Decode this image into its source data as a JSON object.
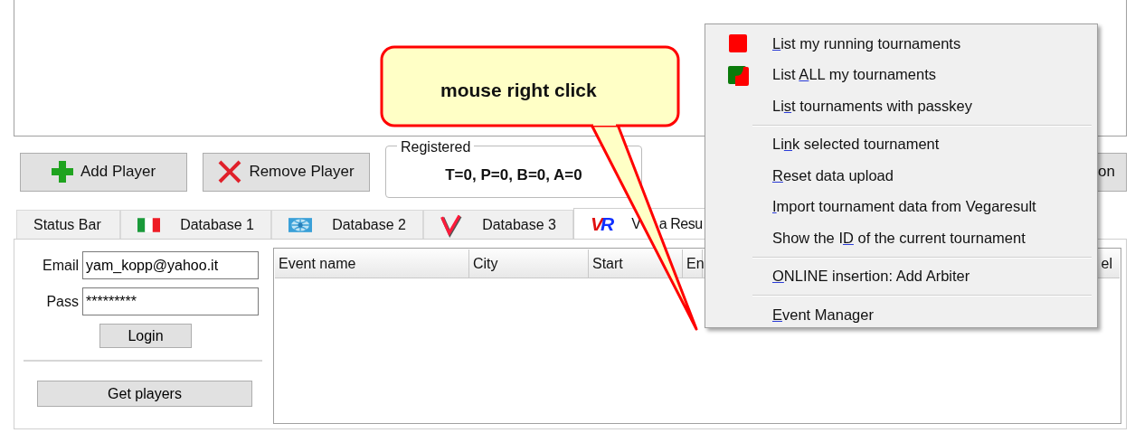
{
  "toolbar": {
    "buttons": [
      "Add Player",
      "Remove Player"
    ],
    "registered": {
      "legend": "Registered",
      "value": "T=0, P=0, B=0, A=0"
    },
    "right_button": {
      "label": "on"
    }
  },
  "tabs": [
    {
      "label": "Status Bar",
      "kind": "plain",
      "selected": false
    },
    {
      "label": "Database 1",
      "kind": "flag",
      "selected": false
    },
    {
      "label": "Database 2",
      "kind": "globe",
      "selected": false
    },
    {
      "label": "Database 3",
      "kind": "vmark",
      "selected": false
    },
    {
      "label": "V",
      "label_rest": "a Resu",
      "kind": "logo",
      "logo": [
        "V",
        "R"
      ],
      "selected": true
    }
  ],
  "login": {
    "email_label": "Email",
    "email": "yam_kopp@yahoo.it",
    "pass_label": "Pass",
    "pass": "*********",
    "login_button": "Login",
    "get_players_button": "Get players"
  },
  "table": {
    "columns": [
      "Event name",
      "City",
      "Start",
      "En"
    ],
    "column_last": "el"
  },
  "callout": {
    "text": "mouse right click"
  },
  "context_menu": {
    "groups": [
      [
        {
          "key": "L",
          "post": "ist my running tournaments",
          "kind": "running"
        },
        {
          "pre": "List ",
          "key": "A",
          "post": "LL my tournaments",
          "kind": "all"
        },
        {
          "pre": "Li",
          "key": "s",
          "post": "t tournaments with passkey",
          "kind": "plain"
        }
      ],
      [
        {
          "pre": "Li",
          "key": "n",
          "post": "k selected tournament",
          "kind": "plain"
        },
        {
          "key": "R",
          "post": "eset data upload",
          "kind": "plain"
        },
        {
          "key": "I",
          "post": "mport tournament data from Vegaresult",
          "kind": "plain"
        },
        {
          "pre": "Show the I",
          "key": "D",
          "post": " of the current tournament",
          "kind": "plain"
        }
      ],
      [
        {
          "key": "O",
          "post": "NLINE insertion: Add Arbiter",
          "kind": "plain"
        }
      ],
      [
        {
          "key": "E",
          "post": "vent Manager",
          "kind": "plain"
        }
      ]
    ]
  }
}
